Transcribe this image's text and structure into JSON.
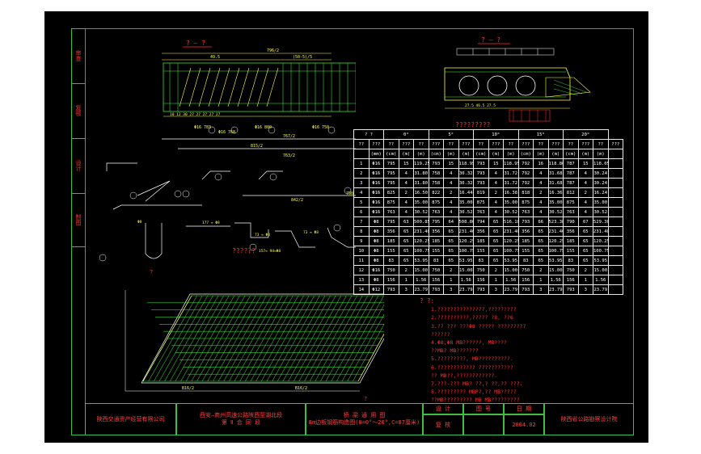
{
  "drawing": {
    "side_labels": [
      "审查",
      "复核",
      "设计",
      "制图"
    ],
    "section_title_top": "? — ?",
    "section_title_right": "? — ?",
    "table_title": "?????????",
    "plan_title": "??????",
    "upper_dims": [
      "796/2",
      "49.5",
      "(50-5)/5",
      "16/2"
    ],
    "bar_labels": [
      {
        "id": "9",
        "text": "Φ16 783"
      },
      {
        "id": "10",
        "text": "Φ16 768"
      },
      {
        "id": "8",
        "text": "Φ16 800"
      },
      {
        "id": "12",
        "text": "Φ16 750"
      }
    ],
    "detail_dims": [
      "767/2",
      "815/2",
      "763/2",
      "842/2",
      "750"
    ],
    "plan_dims": [
      "B16/2",
      "B16/2"
    ]
  },
  "table": {
    "group_headers": [
      "? ?",
      "0°",
      "5°",
      "10°",
      "15°",
      "20°"
    ],
    "sub_headers": [
      "??",
      "???",
      "??",
      "???",
      "??",
      "???",
      "??",
      "???",
      "??",
      "???",
      "??",
      "???",
      "??",
      "???",
      "??",
      "???",
      "??",
      "???"
    ],
    "unit_row": [
      "",
      "(mm)",
      "(cm)",
      "(m)",
      "(m)",
      "(cm)",
      "(m)",
      "(m)",
      "(cm)",
      "(m)",
      "(m)",
      "(cm)",
      "(m)",
      "(m)",
      "(cm)",
      "(m)",
      "(m)",
      ""
    ],
    "rows": [
      [
        "1",
        "Φ16",
        "795",
        "15",
        "119.25",
        "793",
        "15",
        "118.95",
        "793",
        "15",
        "118.95",
        "792",
        "16",
        "118.80",
        "787",
        "15",
        "118.05"
      ],
      [
        "2",
        "Φ16",
        "795",
        "4",
        "31.80",
        "758",
        "4",
        "30.32",
        "793",
        "4",
        "31.72",
        "792",
        "4",
        "31.68",
        "787",
        "4",
        "30.24"
      ],
      [
        "3",
        "Φ16",
        "795",
        "4",
        "31.80",
        "758",
        "4",
        "30.32",
        "793",
        "4",
        "31.72",
        "792",
        "4",
        "31.68",
        "787",
        "4",
        "30.24"
      ],
      [
        "4",
        "Φ16",
        "825",
        "2",
        "16.50",
        "822",
        "2",
        "16.44",
        "819",
        "2",
        "16.38",
        "818",
        "2",
        "16.36",
        "812",
        "2",
        "16.24"
      ],
      [
        "5",
        "Φ16",
        "875",
        "4",
        "35.00",
        "875",
        "4",
        "35.00",
        "875",
        "4",
        "35.00",
        "875",
        "4",
        "35.00",
        "875",
        "4",
        "35.00"
      ],
      [
        "6",
        "Φ16",
        "763",
        "4",
        "30.52",
        "763",
        "4",
        "30.52",
        "763",
        "4",
        "30.52",
        "763",
        "4",
        "30.52",
        "763",
        "4",
        "30.52"
      ],
      [
        "7",
        "Φ8",
        "795",
        "63",
        "500.85",
        "795",
        "64",
        "508.80",
        "794",
        "65",
        "516.10",
        "793",
        "66",
        "523.38",
        "790",
        "67",
        "529.30"
      ],
      [
        "8",
        "Φ8",
        "356",
        "65",
        "231.40",
        "356",
        "65",
        "231.40",
        "356",
        "65",
        "231.40",
        "356",
        "65",
        "231.40",
        "356",
        "65",
        "231.40"
      ],
      [
        "9",
        "Φ8",
        "185",
        "65",
        "120.25",
        "185",
        "65",
        "120.25",
        "185",
        "65",
        "120.25",
        "185",
        "65",
        "120.25",
        "185",
        "65",
        "120.25"
      ],
      [
        "10",
        "Φ8",
        "155",
        "65",
        "100.75",
        "155",
        "65",
        "100.75",
        "155",
        "65",
        "100.75",
        "155",
        "65",
        "100.75",
        "155",
        "65",
        "100.75"
      ],
      [
        "11",
        "Φ8",
        "83",
        "65",
        "53.95",
        "83",
        "65",
        "53.95",
        "83",
        "65",
        "53.95",
        "83",
        "65",
        "53.95",
        "83",
        "65",
        "53.95"
      ],
      [
        "12",
        "Φ16",
        "750",
        "2",
        "15.00",
        "750",
        "2",
        "15.00",
        "750",
        "2",
        "15.00",
        "750",
        "2",
        "15.00",
        "750",
        "2",
        "15.00"
      ],
      [
        "13",
        "Φ8",
        "156",
        "1",
        "1.56",
        "156",
        "1",
        "1.56",
        "156",
        "1",
        "1.56",
        "156",
        "1",
        "1.56",
        "156",
        "1",
        "1.56"
      ],
      [
        "14",
        "Φ12",
        "793",
        "3",
        "23.79",
        "793",
        "3",
        "23.79",
        "793",
        "3",
        "23.79",
        "793",
        "3",
        "23.79",
        "793",
        "3",
        "23.79"
      ]
    ]
  },
  "notes": {
    "title": "? ?:",
    "lines": [
      "1.???????????????,?????????",
      "2.??????????,?????  ?8, ??6",
      "3.??  ???  ???Φ8  ?????  ?????????",
      "   ??????",
      "4.Φ8,Φ8  MB??????,   MB????",
      "   ??MB?  MB???????",
      "5.?????????,  MB??????????.",
      "6.???????????? ???????????",
      "   ?? MB??,????????????.",
      "7.???-???  MB?  ??,?  ??,??     ???.",
      "8.?????????   MBP?,??    MB?????",
      "   ??MB?????????  MB  MB?????????"
    ]
  },
  "title_block": {
    "company": "陕西交通资产经营有限公司",
    "project_line1": "西安—商州高速公路陕西至湖北段",
    "project_line2": "第 Ⅱ 合 同 段",
    "drawing_line1": "桥 梁 通 用 图",
    "drawing_line2": "8m边板钢筋构造图(θ=0°～20°,C=87厘米)",
    "design_label": "设 计",
    "drawing_no_label": "图 号",
    "date_label": "日 期",
    "review_label": "复 核",
    "date_value": "2004.02",
    "institute": "陕西省公路勘察设计院"
  },
  "colors": {
    "background": "#000000",
    "frame_green": "#3fbf3f",
    "frame_magenta": "#d040d0",
    "text_red": "#ff3030",
    "line_yellow": "#ffff40",
    "rebar_green": "#40ff40",
    "line_white": "#ffffff"
  }
}
